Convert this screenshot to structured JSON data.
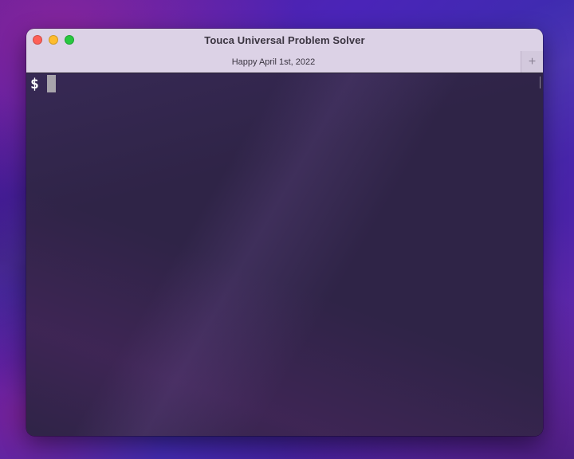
{
  "window": {
    "title": "Touca Universal Problem Solver"
  },
  "tabs": [
    {
      "label": "Happy April 1st, 2022",
      "active": true
    }
  ],
  "new_tab": {
    "label": "+",
    "icon": "plus-icon"
  },
  "terminal": {
    "prompt": "$",
    "input": "",
    "background": "#2f2447",
    "foreground": "#ffffff",
    "cursor_color": "#a8a4ac"
  },
  "colors": {
    "titlebar": "#dcd2e6",
    "close": "#fe5f57",
    "minimize": "#febc2e",
    "maximize": "#28c840"
  }
}
